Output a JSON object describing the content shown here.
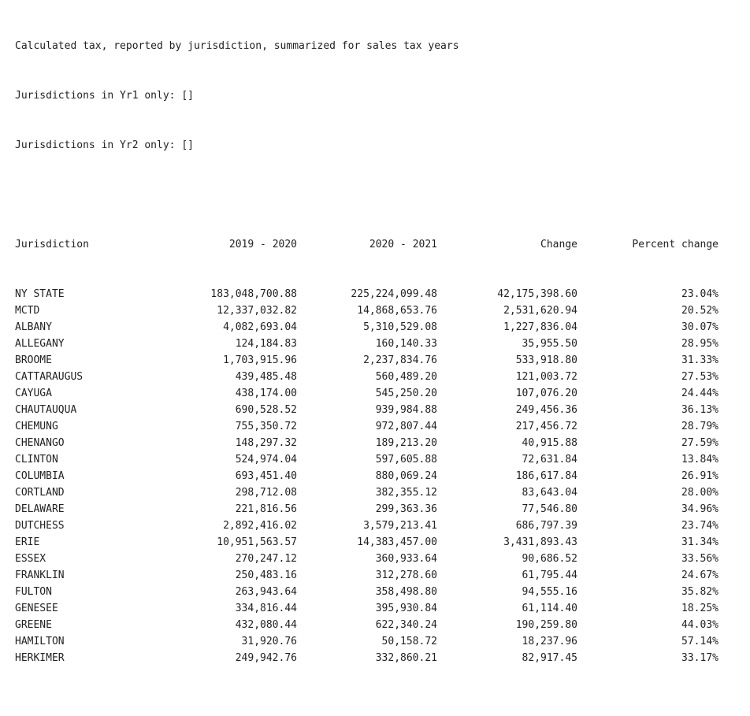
{
  "header_lines": [
    "Calculated tax, reported by jurisdiction, summarized for sales tax years",
    "Jurisdictions in Yr1 only: []",
    "Jurisdictions in Yr2 only: []"
  ],
  "table": {
    "columns": [
      "Jurisdiction",
      "2019 - 2020",
      "2020 - 2021",
      "Change",
      "Percent change"
    ],
    "rows": [
      [
        "NY STATE",
        "183,048,700.88",
        "225,224,099.48",
        "42,175,398.60",
        "23.04%"
      ],
      [
        "MCTD",
        "12,337,032.82",
        "14,868,653.76",
        "2,531,620.94",
        "20.52%"
      ],
      [
        "ALBANY",
        "4,082,693.04",
        "5,310,529.08",
        "1,227,836.04",
        "30.07%"
      ],
      [
        "ALLEGANY",
        "124,184.83",
        "160,140.33",
        "35,955.50",
        "28.95%"
      ],
      [
        "BROOME",
        "1,703,915.96",
        "2,237,834.76",
        "533,918.80",
        "31.33%"
      ],
      [
        "CATTARAUGUS",
        "439,485.48",
        "560,489.20",
        "121,003.72",
        "27.53%"
      ],
      [
        "CAYUGA",
        "438,174.00",
        "545,250.20",
        "107,076.20",
        "24.44%"
      ],
      [
        "CHAUTAUQUA",
        "690,528.52",
        "939,984.88",
        "249,456.36",
        "36.13%"
      ],
      [
        "CHEMUNG",
        "755,350.72",
        "972,807.44",
        "217,456.72",
        "28.79%"
      ],
      [
        "CHENANGO",
        "148,297.32",
        "189,213.20",
        "40,915.88",
        "27.59%"
      ],
      [
        "CLINTON",
        "524,974.04",
        "597,605.88",
        "72,631.84",
        "13.84%"
      ],
      [
        "COLUMBIA",
        "693,451.40",
        "880,069.24",
        "186,617.84",
        "26.91%"
      ],
      [
        "CORTLAND",
        "298,712.08",
        "382,355.12",
        "83,643.04",
        "28.00%"
      ],
      [
        "DELAWARE",
        "221,816.56",
        "299,363.36",
        "77,546.80",
        "34.96%"
      ],
      [
        "DUTCHESS",
        "2,892,416.02",
        "3,579,213.41",
        "686,797.39",
        "23.74%"
      ],
      [
        "ERIE",
        "10,951,563.57",
        "14,383,457.00",
        "3,431,893.43",
        "31.34%"
      ],
      [
        "ESSEX",
        "270,247.12",
        "360,933.64",
        "90,686.52",
        "33.56%"
      ],
      [
        "FRANKLIN",
        "250,483.16",
        "312,278.60",
        "61,795.44",
        "24.67%"
      ],
      [
        "FULTON",
        "263,943.64",
        "358,498.80",
        "94,555.16",
        "35.82%"
      ],
      [
        "GENESEE",
        "334,816.44",
        "395,930.84",
        "61,114.40",
        "18.25%"
      ],
      [
        "GREENE",
        "432,080.44",
        "622,340.24",
        "190,259.80",
        "44.03%"
      ],
      [
        "HAMILTON",
        "31,920.76",
        "50,158.72",
        "18,237.96",
        "57.14%"
      ],
      [
        "HERKIMER",
        "249,942.76",
        "332,860.21",
        "82,917.45",
        "33.17%"
      ]
    ]
  }
}
